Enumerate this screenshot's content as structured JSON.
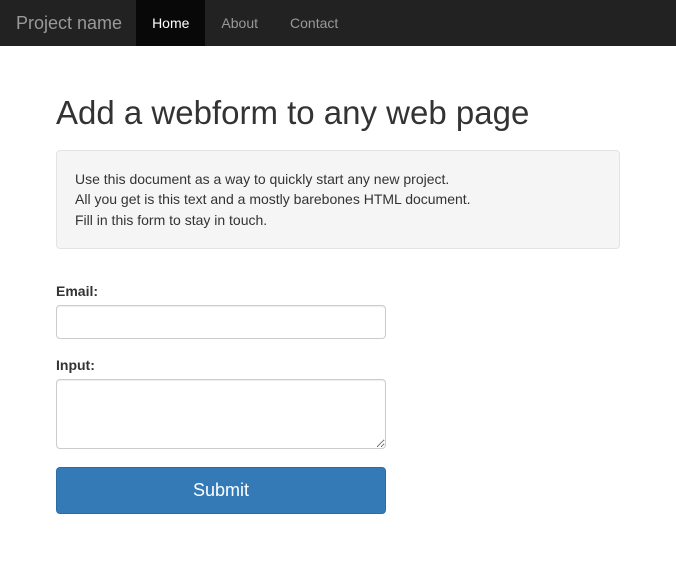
{
  "navbar": {
    "brand": "Project name",
    "items": [
      {
        "label": "Home",
        "active": true
      },
      {
        "label": "About",
        "active": false
      },
      {
        "label": "Contact",
        "active": false
      }
    ]
  },
  "page": {
    "heading": "Add a webform to any web page",
    "intro_lines": [
      "Use this document as a way to quickly start any new project.",
      "All you get is this text and a mostly barebones HTML document.",
      "Fill in this form to stay in touch."
    ]
  },
  "form": {
    "email_label": "Email:",
    "email_value": "",
    "input_label": "Input:",
    "input_value": "",
    "submit_label": "Submit"
  }
}
